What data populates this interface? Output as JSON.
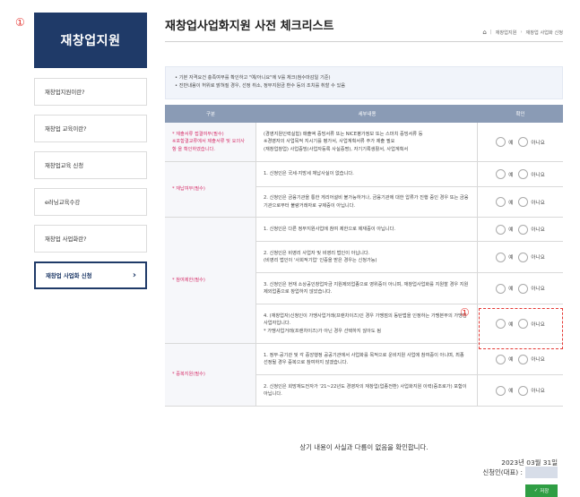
{
  "markers": {
    "top_left": "①",
    "highlight": "①"
  },
  "sidebar": {
    "title": "재창업지원",
    "items": [
      {
        "label": "재창업지원이란?"
      },
      {
        "label": "재창업 교육이란?"
      },
      {
        "label": "재창업교육 신청"
      },
      {
        "label": "e러닝교육수강"
      },
      {
        "label": "재창업 사업화란?"
      },
      {
        "label": "재창업 사업화 신청",
        "active": true,
        "chevron": "›"
      }
    ]
  },
  "header": {
    "title": "재창업사업화지원 사전 체크리스트",
    "breadcrumb": [
      "재창업지원",
      "재창업 사업화 신청"
    ],
    "home_icon": "home-icon"
  },
  "notice": {
    "lines": [
      "• 기본 자격요건 충족여부를 확인하고 \"예/아니요\"에 V를 체크(첨수마감일 기준)",
      "• 진반내용이 허위로 밝혀질 경우, 선정 취소, 정부지원금 환수 등의 조치를 취할 수 있음"
    ]
  },
  "table": {
    "headers": [
      "구분",
      "세부내용",
      "확인"
    ],
    "yes_label": "예",
    "no_label": "아니요",
    "groups": [
      {
        "label": "* 재출서류 접결여부(필수)\n※포함결교류에서 제출서류 및 요의사항 을 확인하였습니다.",
        "rows": [
          "(경영지원인력실험) 매출액 증빙서류 또는 NICE평가정보 또는 스마치 증빙서류 등\n※경영자의 사업목적 지시기를 평가서, 사업계획서류 주가 제출 필요\n(재창업창업) 사업중빙(사업자등록 사실증명), 자기기록생활서, 사업계획서"
        ]
      },
      {
        "label": "* 재납여부(필수)",
        "rows": [
          "1. 신청인은 국세·지방세 체납사실이 없습니다.",
          "2. 신청인은 금융기관을 통한 게리어설비 불가능하거나, 금융기관에 대한 압류가 진행 중인 경우 또는 금융기관으로부터 불량거래자로 규제중이 아닙니다."
        ]
      },
      {
        "label": "* 참여제한(필수)",
        "rows": [
          "1. 신청인은 다른 정부지원사업에 참여 제한으로 제재중이 아닙니다.",
          "2. 신청인은 비영리 사업자 및 비영리 법인이 아닙니다.\n(비영리 법인이 '사회적기업' 인증을 받은 경우는 신청가능)",
          "3. 신청인은 현재 소상공인창업자금 지원제외업종으로 영위중이 아니며, 재창업사업화를 지원할 경우 지원제외업종으로 창업하지 않았습니다.",
          "4. (재창업자)신청인이 가맹사업거래(프랜차이즈)인 경우 가맹점의 동탄법을 인정하는 가맹본부의 가맹점 사업자입니다.\n* 가맹사업거래(프랜차이즈)가 아닌 경우 선택하지 않아도 됨"
        ]
      },
      {
        "label": "* 중복지원(필수)",
        "rows": [
          "1. 정부·공기관 및 각 중앙행정 공공기관에서 사업화를 목적으로 운비지원 사업에 참여중이 아니며, 최종 선정될 경우 중복으로 참여하지 않겠습니다.",
          "2. 신청인은 희망재도전자가 '21~22년도 경영자의 재창업(업종전환) 사업화지원 이력(중조로가) 포함이 아닙니다."
        ]
      }
    ]
  },
  "footer": {
    "confirm_text": "상기 내용이 사실과 다름이 없음을 확인합니다.",
    "date": "2023년 03월 31일",
    "applicant_label": "신청인(대표) :",
    "save_label": "저장",
    "save_icon": "✓"
  },
  "colors": {
    "navy": "#1f3a68",
    "table_header": "#8a9bb5",
    "save": "#2f9e44",
    "highlight": "#e53935"
  }
}
